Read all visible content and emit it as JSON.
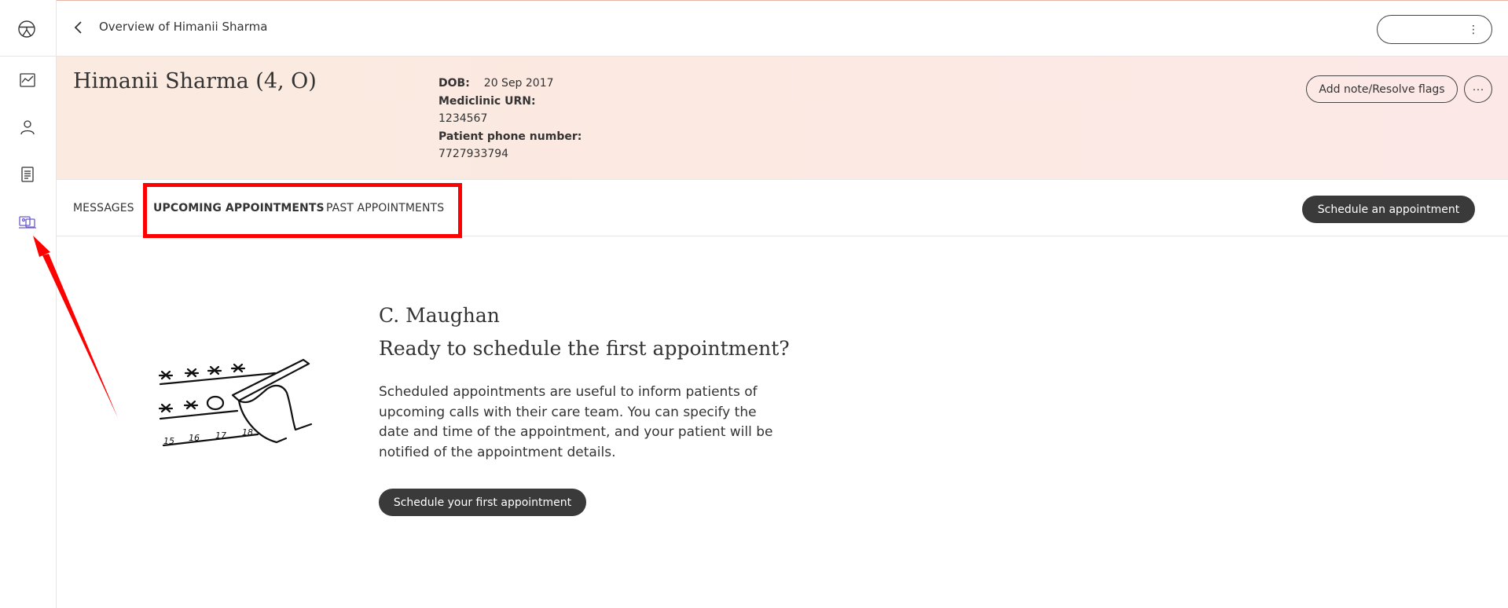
{
  "topbar": {
    "title": "Overview of Himanii Sharma",
    "menu_glyph": "⋮"
  },
  "rail": {
    "icons": [
      "logo-icon",
      "chart-icon",
      "person-icon",
      "document-icon",
      "appointments-icon"
    ],
    "active": "appointments-icon",
    "active_color": "#6a5acd"
  },
  "patient": {
    "name": "Himanii Sharma (4, O)",
    "dob_label": "DOB:",
    "dob_value": "20 Sep 2017",
    "urn_label": "Mediclinic URN:",
    "urn_value": "1234567",
    "phone_label": "Patient phone number:",
    "phone_value": "7727933794",
    "note_button": "Add note/Resolve flags",
    "more_button": "···"
  },
  "tabs": {
    "items": [
      {
        "label": "MESSAGES",
        "active": false
      },
      {
        "label": "UPCOMING APPOINTMENTS",
        "active": true
      },
      {
        "label": "PAST APPOINTMENTS",
        "active": false
      }
    ],
    "schedule_button": "Schedule an appointment"
  },
  "empty_state": {
    "clinician": "C. Maughan",
    "title": "Ready to schedule the first appointment?",
    "description": "Scheduled appointments are useful to inform patients of upcoming calls with their care team. You can specify the date and time of the appointment, and your patient will be notified of the appointment details.",
    "button": "Schedule your first appointment",
    "illustration_numbers": [
      "15",
      "16",
      "17",
      "18"
    ]
  },
  "annotations": {
    "highlight_color": "#ff0000"
  }
}
